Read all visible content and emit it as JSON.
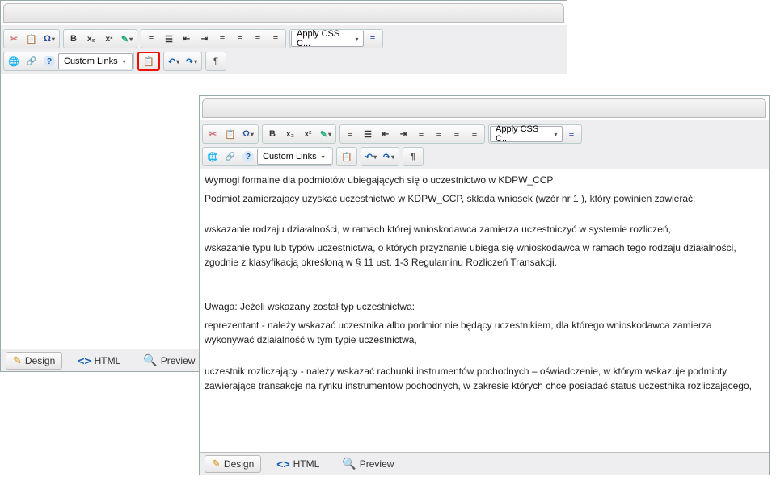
{
  "toolbar": {
    "apply_css_label": "Apply CSS C...",
    "custom_links_label": "Custom Links"
  },
  "modes": {
    "design": "Design",
    "html": "HTML",
    "preview": "Preview"
  },
  "editor2": {
    "p1": "Wymogi formalne dla podmiotów ubiegających się o uczestnictwo w KDPW_CCP",
    "p2": "Podmiot zamierzający uzyskać uczestnictwo w KDPW_CCP, składa wniosek (wzór nr 1 ), który powinien zawierać:",
    "p3": "wskazanie rodzaju działalności, w ramach której wnioskodawca zamierza uczestniczyć w systemie rozliczeń,",
    "p4": "wskazanie typu lub typów uczestnictwa, o których przyznanie ubiega się wnioskodawca w ramach tego rodzaju działalności, zgodnie z klasyfikacją określoną w § 11 ust. 1-3 Regulaminu Rozliczeń Transakcji.",
    "p5": "Uwaga: Jeżeli wskazany został typ uczestnictwa:",
    "p6": "reprezentant - należy wskazać uczestnika albo podmiot nie będący uczestnikiem, dla którego wnioskodawca zamierza wykonywać działalność w tym typie uczestnictwa,",
    "p7": "uczestnik rozliczający - należy wskazać rachunki instrumentów pochodnych – oświadczenie, w którym wskazuje podmioty zawierające transakcje na rynku instrumentów pochodnych, w zakresie których chce posiadać status uczestnika rozliczającego,"
  }
}
